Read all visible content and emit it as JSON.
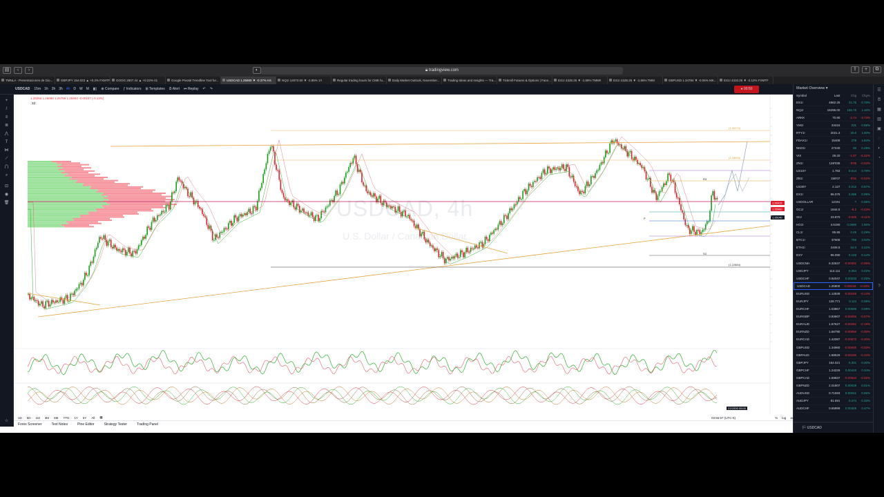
{
  "browser": {
    "url": "tradingview.com",
    "tabs": [
      "TMNLA - Presentaciones de Gio...",
      "GBPJPY 154.033 ▲ +0.2% FXMTF",
      "GOOG 2807.44 ▲ +0.22% 01",
      "Google Pivotal Trendline Tool for...",
      "USDCAD 1.25900 ▼ -0.37% H4",
      "NQ1! 14073.50 ▼ -2.85% 1!!",
      "Regular trading hours for CME fu...",
      "Daily Market Outlook, November...",
      "Trading Ideas and Insights — Tra...",
      "Tickmill Futures & Options | Face...",
      "ES1! 4335.25 ▼ -1.58% TMM!!",
      "ES1! 4335.25 ▼ -1.56% TMM",
      "GBPUSD 1.34784 ▼ -0.06% MK...",
      "ES1! 4310.25 ▼ -2.12% FXMTF"
    ],
    "active_tab": 4
  },
  "toolbar": {
    "symbol": "USDCAD",
    "intervals": [
      "15m",
      "1h",
      "2h",
      "3h",
      "4h",
      "D",
      "W",
      "M"
    ],
    "compare": "Compare",
    "indicators": "Indicators",
    "templates": "Templates",
    "alert": "Alert",
    "replay": "Replay",
    "rec_time": "00:50"
  },
  "chart": {
    "ohlc": "1.26055 1.26088 1.25799 1.25900 -0.00157 (-0.13%)",
    "indicator_count": "12",
    "watermark_symbol": "USDCAD, 4h",
    "watermark_name": "U.S. Dollar / Canadian Dollar",
    "fib_labels": [
      "(1.30274)",
      "(1.28694)",
      "(1.22884)"
    ],
    "level_labels": [
      "R3",
      "P",
      "S3"
    ],
    "price_tags": [
      "1.26415",
      "1.25900",
      "1.25140"
    ],
    "colors": {
      "up": "#26a69a",
      "down": "#ef5350",
      "green": "#1a9a1a",
      "red": "#e01c2c",
      "orange": "#e8a33a"
    }
  },
  "ranges": [
    "1D",
    "5D",
    "1M",
    "3M",
    "6M",
    "YTD",
    "1Y",
    "5Y",
    "All"
  ],
  "clock": "03:55:57 (UTC-5)",
  "scale_opts": [
    "%",
    "log",
    "auto"
  ],
  "panels": [
    "Forex Screener",
    "Text Notes",
    "Pine Editor",
    "Strategy Tester",
    "Trading Panel"
  ],
  "watchlist": {
    "title": "Market Overview",
    "cols": [
      "Symbol",
      "Last",
      "Chg",
      "Chg%"
    ],
    "rows": [
      {
        "s": "ES1!",
        "l": "4582.25",
        "c": "31.75",
        "p": "0.78%",
        "up": true
      },
      {
        "s": "NQ1!",
        "l": "16296.00",
        "c": "155.75",
        "p": "1.10%",
        "up": true
      },
      {
        "s": "ARKK",
        "l": "70.80",
        "c": "-2.74",
        "p": "-3.73%",
        "up": false
      },
      {
        "s": "YM1!",
        "l": "34415",
        "c": "231",
        "p": "0.68%",
        "up": true
      },
      {
        "s": "RTY1!",
        "l": "2021.3",
        "c": "20.0",
        "p": "1.00%",
        "up": true
      },
      {
        "s": "FDAX1!",
        "l": "15409",
        "c": "278",
        "p": "1.84%",
        "up": true
      },
      {
        "s": "NKD1!",
        "l": "27240",
        "c": "80",
        "p": "0.29%",
        "up": true
      },
      {
        "s": "VIX",
        "l": "29.20",
        "c": "-1.97",
        "p": "-6.32%",
        "up": false
      },
      {
        "s": "ZN1!",
        "l": "128'035",
        "c": "-0'05",
        "p": "-0.04%",
        "up": false
      },
      {
        "s": "US10Y",
        "l": "1.783",
        "c": "0.014",
        "p": "0.79%",
        "up": true
      },
      {
        "s": "ZB1!",
        "l": "155'07",
        "c": "-0'01",
        "p": "-0.02%",
        "up": false
      },
      {
        "s": "US30Y",
        "l": "2.127",
        "c": "0.012",
        "p": "0.57%",
        "up": true
      },
      {
        "s": "DX1!",
        "l": "96.075",
        "c": "0.085",
        "p": "0.09%",
        "up": true
      },
      {
        "s": "USDOLLAR",
        "l": "12191",
        "c": "7",
        "p": "0.06%",
        "up": true
      },
      {
        "s": "GC1!",
        "l": "1844.5",
        "c": "-8.2",
        "p": "-0.43%",
        "up": false
      },
      {
        "s": "SI1!",
        "l": "23.870",
        "c": "-0.005",
        "p": "-0.11%",
        "up": false
      },
      {
        "s": "HG1!",
        "l": "4.5190",
        "c": "0.0690",
        "p": "1.55%",
        "up": true
      },
      {
        "s": "CL1!",
        "l": "85.85",
        "c": "0.25",
        "p": "0.29%",
        "up": true
      },
      {
        "s": "BTC1!",
        "l": "37605",
        "c": "750",
        "p": "2.04%",
        "up": true
      },
      {
        "s": "ETH1!",
        "l": "2408.5",
        "c": "54.0",
        "p": "2.22%",
        "up": true
      },
      {
        "s": "DXY",
        "l": "96.090",
        "c": "0.133",
        "p": "0.14%",
        "up": true
      },
      {
        "s": "USDCNH",
        "l": "6.32637",
        "c": "-0.00301",
        "p": "-0.06%",
        "up": false
      },
      {
        "s": "USDJPY",
        "l": "114.111",
        "c": "0.254",
        "p": "0.22%",
        "up": true
      },
      {
        "s": "USDCHF",
        "l": "0.92047",
        "c": "0.00233",
        "p": "0.25%",
        "up": true
      },
      {
        "s": "USDCAD",
        "l": "1.25900",
        "c": "-0.00348",
        "p": "-0.33%",
        "up": false
      },
      {
        "s": "EURUSD",
        "l": "1.12839",
        "c": "-0.00150",
        "p": "-0.13%",
        "up": false
      },
      {
        "s": "EURJPY",
        "l": "128.771",
        "c": "0.114",
        "p": "0.09%",
        "up": true
      },
      {
        "s": "EURCHF",
        "l": "1.03867",
        "c": "0.00096",
        "p": "0.09%",
        "up": true
      },
      {
        "s": "EURGBP",
        "l": "0.83607",
        "c": "-0.00055",
        "p": "-0.07%",
        "up": false
      },
      {
        "s": "EURAUD",
        "l": "1.57627",
        "c": "-0.00281",
        "p": "-0.18%",
        "up": false
      },
      {
        "s": "EURNZD",
        "l": "1.66790",
        "c": "-0.00094",
        "p": "-0.06%",
        "up": false
      },
      {
        "s": "EURCAD",
        "l": "1.42087",
        "c": "-0.00572",
        "p": "-0.40%",
        "up": false
      },
      {
        "s": "GBPUSD",
        "l": "1.34960",
        "c": "-0.00040",
        "p": "-0.03%",
        "up": false
      },
      {
        "s": "GBPAUD",
        "l": "1.88529",
        "c": "-0.00190",
        "p": "-0.10%",
        "up": false
      },
      {
        "s": "GBPJPY",
        "l": "154.021",
        "c": "0.301",
        "p": "0.20%",
        "up": true
      },
      {
        "s": "GBPCHF",
        "l": "1.24229",
        "c": "0.00420",
        "p": "0.34%",
        "up": true
      },
      {
        "s": "GBPCAD",
        "l": "1.69937",
        "c": "-0.00544",
        "p": "-0.32%",
        "up": false
      },
      {
        "s": "GBPNZD",
        "l": "2.01807",
        "c": "0.00028",
        "p": "0.01%",
        "up": true
      },
      {
        "s": "AUDUSD",
        "l": "0.71593",
        "c": "0.00041",
        "p": "0.06%",
        "up": true
      },
      {
        "s": "AUDJPY",
        "l": "81.691",
        "c": "0.274",
        "p": "0.33%",
        "up": true
      },
      {
        "s": "AUDCHF",
        "l": "0.65899",
        "c": "0.00305",
        "p": "0.47%",
        "up": true
      }
    ],
    "footer_symbol": "USDCAD"
  }
}
